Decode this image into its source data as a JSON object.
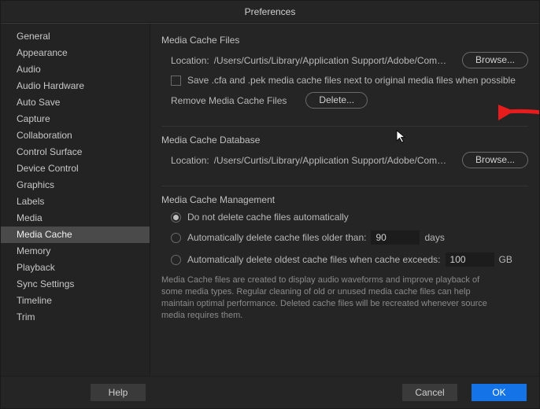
{
  "title": "Preferences",
  "sidebar": {
    "items": [
      {
        "label": "General"
      },
      {
        "label": "Appearance"
      },
      {
        "label": "Audio"
      },
      {
        "label": "Audio Hardware"
      },
      {
        "label": "Auto Save"
      },
      {
        "label": "Capture"
      },
      {
        "label": "Collaboration"
      },
      {
        "label": "Control Surface"
      },
      {
        "label": "Device Control"
      },
      {
        "label": "Graphics"
      },
      {
        "label": "Labels"
      },
      {
        "label": "Media"
      },
      {
        "label": "Media Cache"
      },
      {
        "label": "Memory"
      },
      {
        "label": "Playback"
      },
      {
        "label": "Sync Settings"
      },
      {
        "label": "Timeline"
      },
      {
        "label": "Trim"
      }
    ],
    "selected_index": 12
  },
  "media_cache_files": {
    "title": "Media Cache Files",
    "location_label": "Location:",
    "location_path": "/Users/Curtis/Library/Application Support/Adobe/Common/",
    "browse_label": "Browse...",
    "checkbox_label": "Save .cfa and .pek media cache files next to original media files when possible",
    "remove_label": "Remove Media Cache Files",
    "delete_label": "Delete..."
  },
  "media_cache_database": {
    "title": "Media Cache Database",
    "location_label": "Location:",
    "location_path": "/Users/Curtis/Library/Application Support/Adobe/Common/",
    "browse_label": "Browse..."
  },
  "media_cache_management": {
    "title": "Media Cache Management",
    "options": [
      {
        "label": "Do not delete cache files automatically"
      },
      {
        "label_prefix": "Automatically delete cache files older than:",
        "value": "90",
        "unit": "days"
      },
      {
        "label_prefix": "Automatically delete oldest cache files when cache exceeds:",
        "value": "100",
        "unit": "GB"
      }
    ],
    "selected_index": 0,
    "help": "Media Cache files are created to display audio waveforms and improve playback of some media types.  Regular cleaning of old or unused media cache files can help maintain optimal performance. Deleted cache files will be recreated whenever source media requires them."
  },
  "footer": {
    "help": "Help",
    "cancel": "Cancel",
    "ok": "OK"
  }
}
